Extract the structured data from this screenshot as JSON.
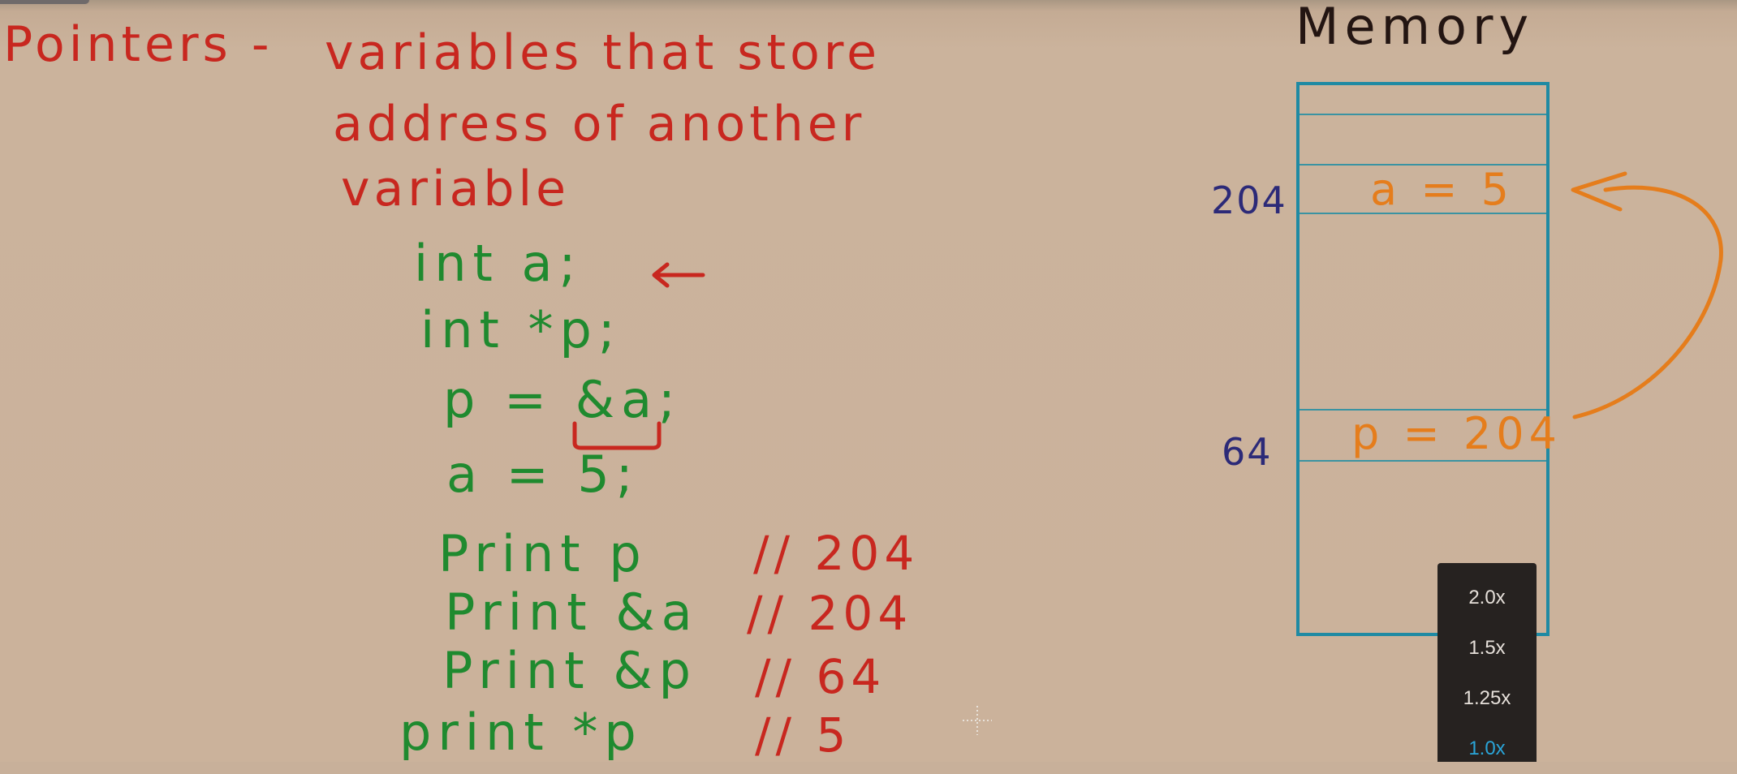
{
  "definition": {
    "heading": "Pointers -",
    "line1": "variables that store",
    "line2": "address of another",
    "line3": "variable"
  },
  "code": {
    "line1": "int a;",
    "line2": "int *p;",
    "line3": "p = &a;",
    "line4": "a = 5;",
    "print1": "Print p",
    "print2": "Print &a",
    "print3": "Print &p",
    "print4": "print *p"
  },
  "comments": {
    "c1": "// 204",
    "c2": "// 204",
    "c3": "// 64",
    "c4": "// 5"
  },
  "memory": {
    "title": "Memory",
    "addr_a": "204",
    "addr_p": "64",
    "cell_a": "a = 5",
    "cell_p": "p = 204"
  },
  "playback_speed": {
    "options": [
      "2.0x",
      "1.5x",
      "1.25x",
      "1.0x"
    ],
    "selected": "1.0x",
    "selected_color": "#2aa5d8"
  },
  "colors": {
    "definition": "#c8271f",
    "code": "#1f8a2f",
    "memory_values": "#e57d1c",
    "addresses": "#2c2a78",
    "memory_box": "#1f8aa3",
    "board": "#cbb39c"
  }
}
